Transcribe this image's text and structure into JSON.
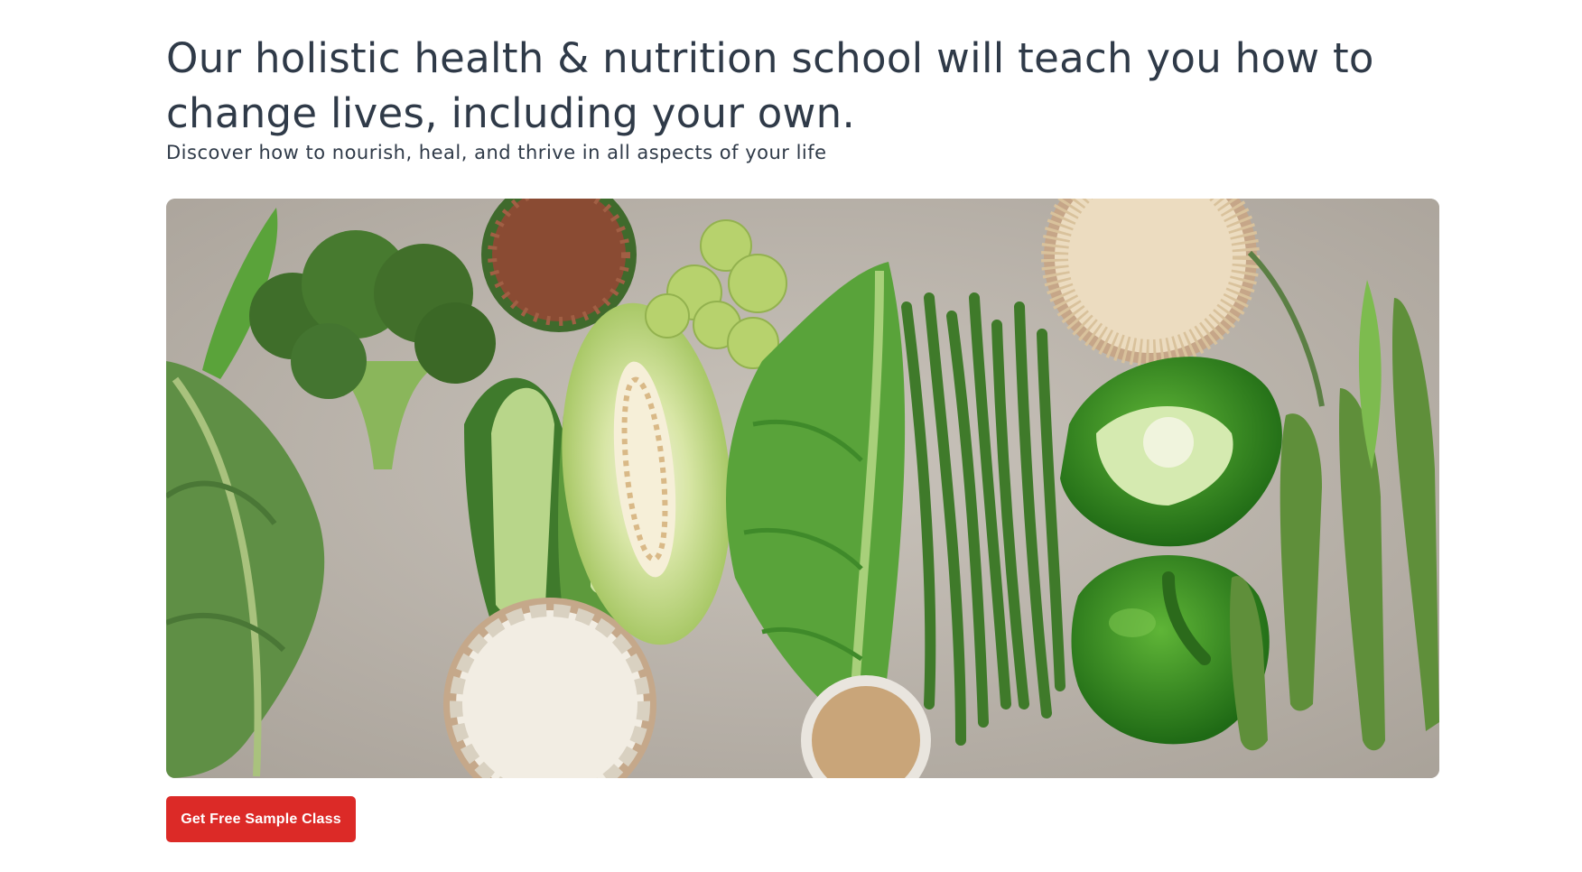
{
  "hero": {
    "headline": "Our holistic health & nutrition school will teach you how to change lives, including your own.",
    "subheadline": "Discover how to nourish, heal, and thrive in all aspects of your life",
    "image_subject": "green-vegetables-and-grains-flatlay",
    "cta_label": "Get Free Sample Class"
  },
  "colors": {
    "heading_text": "#2f3a48",
    "cta_background": "#dc2a27",
    "cta_text": "#ffffff",
    "image_backdrop": "#b8b1a8"
  }
}
